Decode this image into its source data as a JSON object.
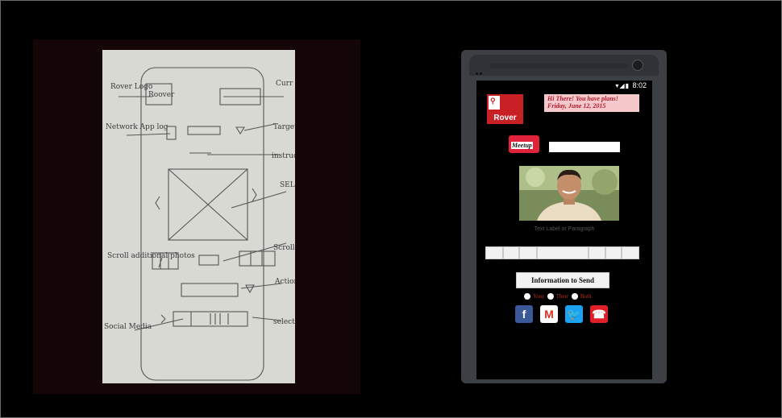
{
  "sketch": {
    "annotations": [
      "Rover Logo",
      "Curr Dat",
      "Network App log",
      "Target",
      "instruc",
      "SEL",
      "Scroll additional photos",
      "Scroll",
      "Action se A B",
      "Social Media",
      "select"
    ],
    "logo_text": "Roover"
  },
  "phone": {
    "status": {
      "time": "8:02",
      "icons": "wifi-signal-battery"
    },
    "logo": {
      "label": "Rover"
    },
    "note": {
      "line1": "Hi There!  You have plans!",
      "line2": "Friday, June 12, 2015"
    },
    "meetup": {
      "label": "Meetup"
    },
    "name_input": {
      "value": "",
      "placeholder": ""
    },
    "photo_caption": "Text Label or Paragraph",
    "send_button": "Information to Send",
    "radios": [
      {
        "label": "Your"
      },
      {
        "label": "Their"
      },
      {
        "label": "Both"
      }
    ],
    "social": [
      {
        "name": "facebook-icon",
        "glyph": "f"
      },
      {
        "name": "gmail-icon",
        "glyph": "M"
      },
      {
        "name": "twitter-icon",
        "glyph": "🐦"
      },
      {
        "name": "phone-icon",
        "glyph": "☎"
      }
    ]
  },
  "colors": {
    "rover_red": "#c82024",
    "note_bg": "#f5c9cc",
    "meetup_red": "#e0223b"
  }
}
